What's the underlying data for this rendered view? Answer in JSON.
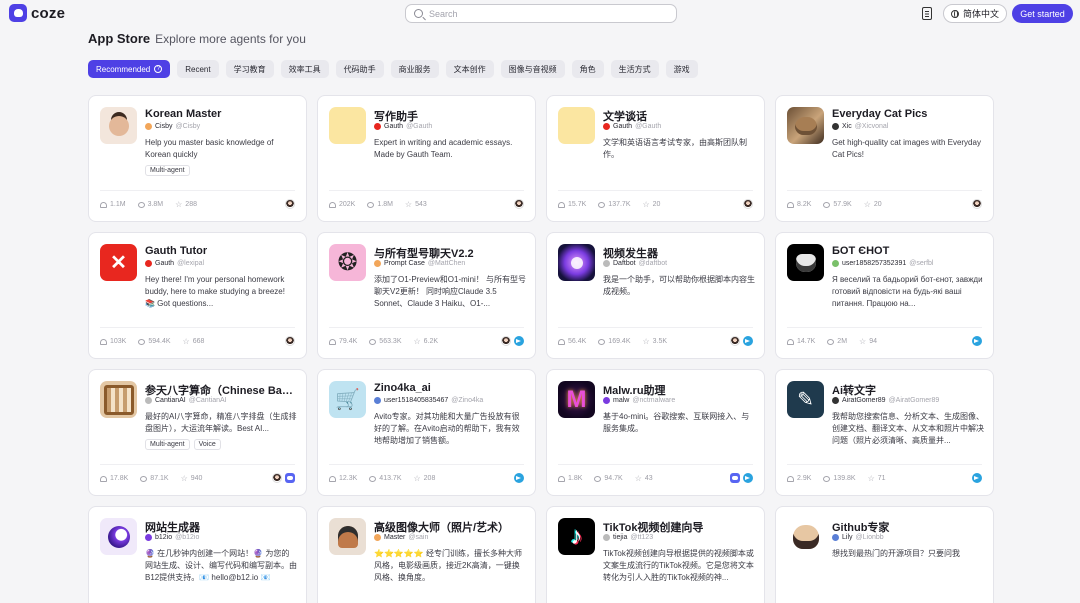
{
  "header": {
    "logo_text": "coze",
    "search_placeholder": "Search",
    "lang_label": "简体中文",
    "cta_label": "Get started"
  },
  "page": {
    "title": "App Store",
    "subtitle": "Explore more agents for you"
  },
  "categories": [
    {
      "label": "Recommended",
      "active": true
    },
    {
      "label": "Recent"
    },
    {
      "label": "学习教育"
    },
    {
      "label": "效率工具"
    },
    {
      "label": "代码助手"
    },
    {
      "label": "商业服务"
    },
    {
      "label": "文本创作"
    },
    {
      "label": "图像与音视频"
    },
    {
      "label": "角色"
    },
    {
      "label": "生活方式"
    },
    {
      "label": "游戏"
    }
  ],
  "cards": [
    {
      "name": "Korean Master",
      "author": "Cisby",
      "handle": "@Cisby",
      "desc": "Help you master basic knowledge of Korean quickly",
      "tags": [
        "Multi-agent"
      ],
      "users": "1.1M",
      "chats": "3.8M",
      "stars": "288",
      "thumb": "t-korean",
      "av": "av-orange",
      "plats": [
        "doubao"
      ]
    },
    {
      "name": "写作助手",
      "author": "Gauth",
      "handle": "@Gauth",
      "desc": "Expert in writing and academic essays. Made by Gauth Team.",
      "tags": [],
      "users": "202K",
      "chats": "1.8M",
      "stars": "543",
      "thumb": "t-writer",
      "thumb_glyph": "✏️",
      "av": "av-red",
      "plats": [
        "doubao"
      ]
    },
    {
      "name": "文学谈话",
      "author": "Gauth",
      "handle": "@Gauth",
      "desc": "文学和英语语言考试专家，由高斯团队制作。",
      "tags": [],
      "users": "15.7K",
      "chats": "137.7K",
      "stars": "20",
      "thumb": "t-lit",
      "thumb_glyph": "✍️",
      "av": "av-red",
      "plats": [
        "doubao"
      ]
    },
    {
      "name": "Everyday Cat Pics",
      "author": "Xic",
      "handle": "@Xicvonal",
      "desc": "Get high-quality cat images with Everyday Cat Pics!",
      "tags": [],
      "users": "8.2K",
      "chats": "57.9K",
      "stars": "20",
      "thumb": "t-cat",
      "av": "av-dark",
      "plats": [
        "doubao"
      ]
    },
    {
      "name": "Gauth Tutor",
      "author": "Gauth",
      "handle": "@lexipal",
      "desc": "Hey there! I'm your personal homework buddy, here to make studying a breeze! 📚 Got questions...",
      "tags": [],
      "users": "103K",
      "chats": "594.4K",
      "stars": "668",
      "thumb": "t-gauth",
      "av": "av-red",
      "plats": [
        "doubao"
      ]
    },
    {
      "name": "与所有型号聊天V2.2",
      "author": "Prompt Case",
      "handle": "@MattChen",
      "desc": "添加了O1-Preview和O1-mini！ 与所有型号聊天V2更新！ 同时响应Claude 3.5 Sonnet、Claude 3 Haiku、O1-...",
      "tags": [],
      "users": "79.4K",
      "chats": "563.3K",
      "stars": "6.2K",
      "thumb": "t-gpt",
      "av": "av-orange",
      "plats": [
        "doubao",
        "telegram"
      ]
    },
    {
      "name": "视频发生器",
      "author": "Daftbot",
      "handle": "@daftbot",
      "desc": "我是一个助手，可以帮助你根据脚本内容生成视频。",
      "tags": [],
      "users": "56.4K",
      "chats": "169.4K",
      "stars": "3.5K",
      "thumb": "t-video",
      "av": "av-gray",
      "plats": [
        "doubao",
        "telegram"
      ]
    },
    {
      "name": "БОТ ЄНОТ",
      "author": "user1858257352391",
      "handle": "@serfbl",
      "desc": "Я веселий та бадьорий бот-єнот, завжди готовий відповісти на будь-які ваші питання. Працюю на...",
      "tags": [],
      "users": "14.7K",
      "chats": "2M",
      "stars": "94",
      "thumb": "t-bot",
      "av": "av-green",
      "plats": [
        "telegram"
      ]
    },
    {
      "name": "参天八字算命（Chinese BaZi）",
      "author": "CantianAI",
      "handle": "@CantianAI",
      "desc": "最好的AI八字算命，精准八字排盘（生成排盘图片），大运流年解读。Best AI...",
      "tags": [
        "Multi-agent",
        "Voice"
      ],
      "users": "17.8K",
      "chats": "87.1K",
      "stars": "940",
      "thumb": "t-bazi",
      "av": "av-gray",
      "plats": [
        "doubao",
        "discord"
      ]
    },
    {
      "name": "Zino4ka_ai",
      "author": "user1518405835467",
      "handle": "@Zino4ka",
      "desc": "Avito专家。对其功能和大量广告投放有很好的了解。在Avito启动的帮助下，我有效地帮助增加了销售额。",
      "tags": [],
      "users": "12.3K",
      "chats": "413.7K",
      "stars": "208",
      "thumb": "t-zino",
      "av": "av-blue",
      "plats": [
        "telegram"
      ]
    },
    {
      "name": "Malw.ru助理",
      "author": "malw",
      "handle": "@nctmalware",
      "desc": "基于4o-mini。谷歌搜索、互联网接入、与服务集成。",
      "tags": [],
      "users": "1.8K",
      "chats": "94.7K",
      "stars": "43",
      "thumb": "t-malw",
      "av": "av-purple",
      "plats": [
        "discord",
        "telegram"
      ]
    },
    {
      "name": "Ai转文字",
      "author": "AiratGomer89",
      "handle": "@AiratGomer89",
      "desc": "我帮助您搜索信息、分析文本、生成图像、创建文档、翻译文本、从文本和照片中解决问题（照片必须清晰、高质量并...",
      "tags": [],
      "users": "2.9K",
      "chats": "139.8K",
      "stars": "71",
      "thumb": "t-ai",
      "av": "av-dark",
      "plats": [
        "telegram"
      ]
    },
    {
      "name": "网站生成器",
      "author": "b12io",
      "handle": "@b12io",
      "desc": "🔮 在几秒钟内创建一个网站！🔮 为您的网站生成、设计、编写代码和编写副本。由B12提供支持。📧 hello@b12.io 📧",
      "tags": [],
      "users": "",
      "chats": "",
      "stars": "",
      "thumb": "t-web",
      "av": "av-purple",
      "plats": []
    },
    {
      "name": "高级图像大师（照片/艺术）",
      "author": "Master",
      "handle": "@sain",
      "desc": "⭐⭐⭐⭐⭐ 经专门训练，擅长多种大师风格，电影级画质，接近2K高清，一键换风格、换角度。",
      "tags": [],
      "users": "",
      "chats": "",
      "stars": "",
      "thumb": "t-img",
      "av": "av-orange",
      "plats": []
    },
    {
      "name": "TikTok视频创建向导",
      "author": "tiejia",
      "handle": "@tt123",
      "desc": "TikTok视频创建向导根据提供的视频脚本或文案生成流行的TikTok视频。它是您将文本转化为引人入胜的TikTok视频的神...",
      "tags": [],
      "users": "",
      "chats": "",
      "stars": "",
      "thumb": "t-tiktok",
      "av": "av-gray",
      "plats": []
    },
    {
      "name": "Github专家",
      "author": "Lily",
      "handle": "@Lionbb",
      "desc": "想找到最热门的开源项目？只要问我",
      "tags": [],
      "users": "",
      "chats": "",
      "stars": "",
      "thumb": "t-github",
      "av": "av-blue",
      "plats": []
    }
  ]
}
